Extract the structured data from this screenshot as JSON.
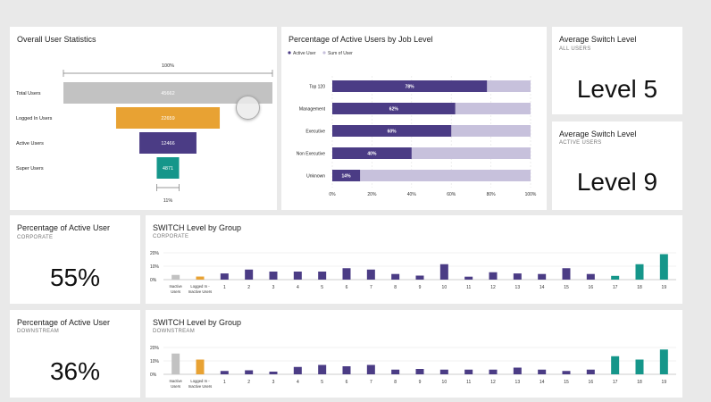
{
  "colors": {
    "purple": "#4b3c85",
    "lavender": "#c7c1dc",
    "gray": "#c2c2c2",
    "orange": "#e8a233",
    "teal": "#15968a"
  },
  "overall": {
    "title": "Overall User Statistics",
    "top_pct": "100%",
    "bottom_pct": "11%",
    "rows": [
      {
        "label": "Total Users",
        "value": "45662",
        "color": "#c2c2c2",
        "frac": 1.0
      },
      {
        "label": "Logged In Users",
        "value": "22659",
        "color": "#e8a233",
        "frac": 0.496
      },
      {
        "label": "Active Users",
        "value": "12466",
        "color": "#4b3c85",
        "frac": 0.273
      },
      {
        "label": "Super Users",
        "value": "4871",
        "color": "#15968a",
        "frac": 0.107
      }
    ]
  },
  "job_level": {
    "title": "Percentage of Active Users by Job Level",
    "legend": [
      "Active User",
      "Sum of User"
    ],
    "x_ticks": [
      "0%",
      "20%",
      "40%",
      "60%",
      "80%",
      "100%"
    ],
    "chart_data": {
      "type": "bar",
      "orientation": "horizontal",
      "categories": [
        "Top 120",
        "Management",
        "Executive",
        "Non Executive",
        "Unknown"
      ],
      "series": [
        {
          "name": "Active User",
          "values": [
            78,
            62,
            60,
            40,
            14
          ]
        },
        {
          "name": "Sum of User",
          "values": [
            100,
            100,
            100,
            100,
            100
          ]
        }
      ],
      "labels": [
        "78%",
        "62%",
        "60%",
        "40%",
        "14%"
      ],
      "xlim": [
        0,
        100
      ]
    }
  },
  "avg_all": {
    "title": "Average Switch Level",
    "subtitle": "ALL USERS",
    "value": "Level 5"
  },
  "avg_active": {
    "title": "Average Switch Level",
    "subtitle": "ACTIVE USERS",
    "value": "Level 9"
  },
  "pct_corp": {
    "title": "Percentage of Active User",
    "subtitle": "CORPORATE",
    "value": "55%"
  },
  "pct_down": {
    "title": "Percentage of Active User",
    "subtitle": "DOWNSTREAM",
    "value": "36%"
  },
  "switch_corp": {
    "title": "SWITCH Level by Group",
    "subtitle": "CORPORATE",
    "y_ticks": [
      "0%",
      "10%",
      "20%"
    ],
    "chart_data": {
      "type": "bar",
      "categories": [
        "Inactive Users",
        "Logged In - Inactive Users",
        "1",
        "2",
        "3",
        "4",
        "5",
        "6",
        "7",
        "8",
        "9",
        "10",
        "11",
        "12",
        "13",
        "14",
        "15",
        "16",
        "17",
        "18",
        "19"
      ],
      "values": [
        3.5,
        2.3,
        4.6,
        7.5,
        6.0,
        6.0,
        6.0,
        8.5,
        7.5,
        4.2,
        3.0,
        11.5,
        2.2,
        5.5,
        4.6,
        4.2,
        8.5,
        4.2,
        2.8,
        11.5,
        19.0
      ],
      "colors": [
        "#c2c2c2",
        "#e8a233",
        "#4b3c85",
        "#4b3c85",
        "#4b3c85",
        "#4b3c85",
        "#4b3c85",
        "#4b3c85",
        "#4b3c85",
        "#4b3c85",
        "#4b3c85",
        "#4b3c85",
        "#4b3c85",
        "#4b3c85",
        "#4b3c85",
        "#4b3c85",
        "#4b3c85",
        "#4b3c85",
        "#15968a",
        "#15968a",
        "#15968a"
      ],
      "ylim": [
        0,
        20
      ]
    }
  },
  "switch_down": {
    "title": "SWITCH Level by Group",
    "subtitle": "DOWNSTREAM",
    "y_ticks": [
      "0%",
      "10%",
      "20%"
    ],
    "chart_data": {
      "type": "bar",
      "categories": [
        "Inactive Users",
        "Logged In - Inactive Users",
        "1",
        "2",
        "3",
        "4",
        "5",
        "6",
        "7",
        "8",
        "9",
        "10",
        "11",
        "12",
        "13",
        "14",
        "15",
        "16",
        "17",
        "18",
        "19"
      ],
      "values": [
        15.5,
        11.0,
        2.5,
        3.0,
        2.0,
        5.5,
        7.0,
        6.0,
        7.0,
        3.5,
        4.0,
        3.5,
        3.5,
        3.5,
        5.0,
        3.5,
        2.5,
        3.5,
        13.5,
        11.0,
        18.5
      ],
      "colors": [
        "#c2c2c2",
        "#e8a233",
        "#4b3c85",
        "#4b3c85",
        "#4b3c85",
        "#4b3c85",
        "#4b3c85",
        "#4b3c85",
        "#4b3c85",
        "#4b3c85",
        "#4b3c85",
        "#4b3c85",
        "#4b3c85",
        "#4b3c85",
        "#4b3c85",
        "#4b3c85",
        "#4b3c85",
        "#4b3c85",
        "#15968a",
        "#15968a",
        "#15968a"
      ],
      "ylim": [
        0,
        20
      ]
    }
  }
}
